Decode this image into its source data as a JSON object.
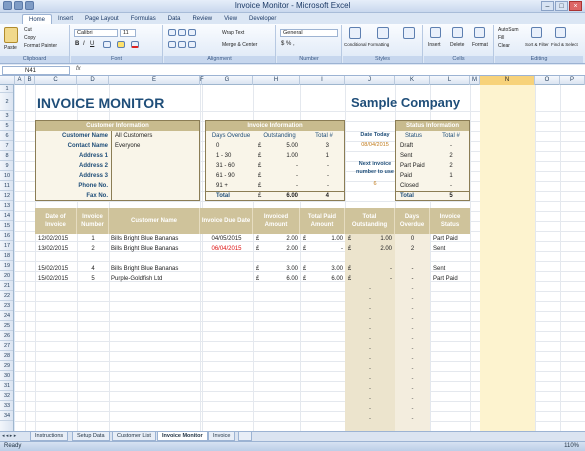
{
  "window": {
    "title": "Invoice Monitor - Microsoft Excel"
  },
  "ribbon_tabs": [
    "Home",
    "Insert",
    "Page Layout",
    "Formulas",
    "Data",
    "Review",
    "View",
    "Developer"
  ],
  "ribbon": {
    "clipboard": {
      "paste": "Paste",
      "cut": "Cut",
      "copy": "Copy",
      "format_painter": "Format Painter",
      "label": "Clipboard"
    },
    "font": {
      "name": "Calibri",
      "size": "11",
      "label": "Font"
    },
    "alignment": {
      "wrap": "Wrap Text",
      "merge": "Merge & Center",
      "label": "Alignment"
    },
    "number": {
      "format": "General",
      "label": "Number"
    },
    "styles": {
      "conditional": "Conditional Formatting",
      "format_table": "Format as Table",
      "cell_styles": "Cell Styles",
      "label": "Styles"
    },
    "cells": {
      "insert": "Insert",
      "delete": "Delete",
      "format": "Format",
      "label": "Cells"
    },
    "editing": {
      "autosum": "AutoSum",
      "fill": "Fill",
      "clear": "Clear",
      "sort": "Sort & Filter",
      "find": "Find & Select",
      "label": "Editing"
    }
  },
  "formula_bar": {
    "name_box": "N41",
    "fx": "fx",
    "formula": ""
  },
  "columns": [
    "A",
    "B",
    "C",
    "D",
    "E",
    "F",
    "G",
    "H",
    "I",
    "J",
    "K",
    "L",
    "M",
    "N",
    "O",
    "P"
  ],
  "rows": [
    "1",
    "2",
    "3",
    "5",
    "6",
    "7",
    "8",
    "9",
    "10",
    "11",
    "12",
    "13",
    "14",
    "15",
    "16",
    "17",
    "18",
    "19",
    "20",
    "21",
    "22",
    "23",
    "24",
    "25",
    "26",
    "27",
    "28",
    "29",
    "30",
    "31",
    "32",
    "33",
    "34"
  ],
  "sheet": {
    "title": "INVOICE MONITOR",
    "company": "Sample Company",
    "customer_info": {
      "header": "Customer Information",
      "rows": [
        {
          "label": "Customer Name",
          "value": "All Customers"
        },
        {
          "label": "Contact Name",
          "value": "Everyone"
        },
        {
          "label": "Address 1",
          "value": ""
        },
        {
          "label": "Address 2",
          "value": ""
        },
        {
          "label": "Address 3",
          "value": ""
        },
        {
          "label": "Phone No.",
          "value": ""
        },
        {
          "label": "Fax No.",
          "value": ""
        }
      ]
    },
    "invoice_info": {
      "header": "Invoice Information",
      "cols": [
        "Days Overdue",
        "Outstanding",
        "Total #"
      ],
      "rows": [
        {
          "bucket": "0",
          "cur": "£",
          "amount": "5.00",
          "count": "3"
        },
        {
          "bucket": "1 - 30",
          "cur": "£",
          "amount": "1.00",
          "count": "1"
        },
        {
          "bucket": "31 - 60",
          "cur": "£",
          "amount": "-",
          "count": "-"
        },
        {
          "bucket": "61 - 90",
          "cur": "£",
          "amount": "-",
          "count": "-"
        },
        {
          "bucket": "91 +",
          "cur": "£",
          "amount": "-",
          "count": "-"
        }
      ],
      "total": {
        "label": "Total",
        "cur": "£",
        "amount": "6.00",
        "count": "4"
      }
    },
    "date_today": {
      "label": "Date Today",
      "value": "08/04/2015"
    },
    "next_invoice": {
      "label1": "Next invoice",
      "label2": "number to use",
      "value": "6"
    },
    "status_info": {
      "header": "Status Information",
      "cols": [
        "Status",
        "Total #"
      ],
      "rows": [
        {
          "status": "Draft",
          "count": "-"
        },
        {
          "status": "Sent",
          "count": "2"
        },
        {
          "status": "Part Paid",
          "count": "2"
        },
        {
          "status": "Paid",
          "count": "1"
        },
        {
          "status": "Closed",
          "count": "-"
        }
      ],
      "total": {
        "label": "Total",
        "count": "5"
      }
    },
    "table_headers": [
      "Date of Invoice",
      "Invoice Number",
      "Customer Name",
      "Invoice Due Date",
      "Invoiced Amount",
      "Total Paid Amount",
      "Total Outstanding",
      "Days Overdue",
      "Invoice Status"
    ],
    "invoices": [
      {
        "date": "12/02/2015",
        "num": "1",
        "customer": "Bills Bright Blue Bananas",
        "due": "04/05/2015",
        "amt": "2.00",
        "paid": "1.00",
        "out": "1.00",
        "overdue": "0",
        "status": "Part Paid",
        "due_color": "#222"
      },
      {
        "date": "13/02/2015",
        "num": "2",
        "customer": "Bills Bright Blue Bananas",
        "due": "06/04/2015",
        "amt": "2.00",
        "paid": "-",
        "out": "2.00",
        "overdue": "2",
        "status": "Sent",
        "due_color": "#d11"
      },
      {
        "date": "",
        "num": "",
        "customer": "",
        "due": "",
        "amt": "",
        "paid": "",
        "out": "",
        "overdue": "",
        "status": "",
        "due_color": "#222"
      },
      {
        "date": "15/02/2015",
        "num": "4",
        "customer": "Bills Bright Blue Bananas",
        "due": "",
        "amt": "3.00",
        "paid": "3.00",
        "out": "-",
        "overdue": "-",
        "status": "Sent",
        "due_color": "#222"
      },
      {
        "date": "15/02/2015",
        "num": "5",
        "customer": "Purple-Goldfish Ltd",
        "due": "",
        "amt": "6.00",
        "paid": "6.00",
        "out": "-",
        "overdue": "-",
        "status": "Part Paid",
        "due_color": "#222"
      }
    ],
    "currency": "£",
    "dash": "-"
  },
  "sheet_tabs": [
    "Instructions",
    "Setup Data",
    "Customer List",
    "Invoice Monitor",
    "Invoice"
  ],
  "active_sheet": "Invoice Monitor",
  "status": {
    "ready": "Ready",
    "zoom": "110%"
  }
}
